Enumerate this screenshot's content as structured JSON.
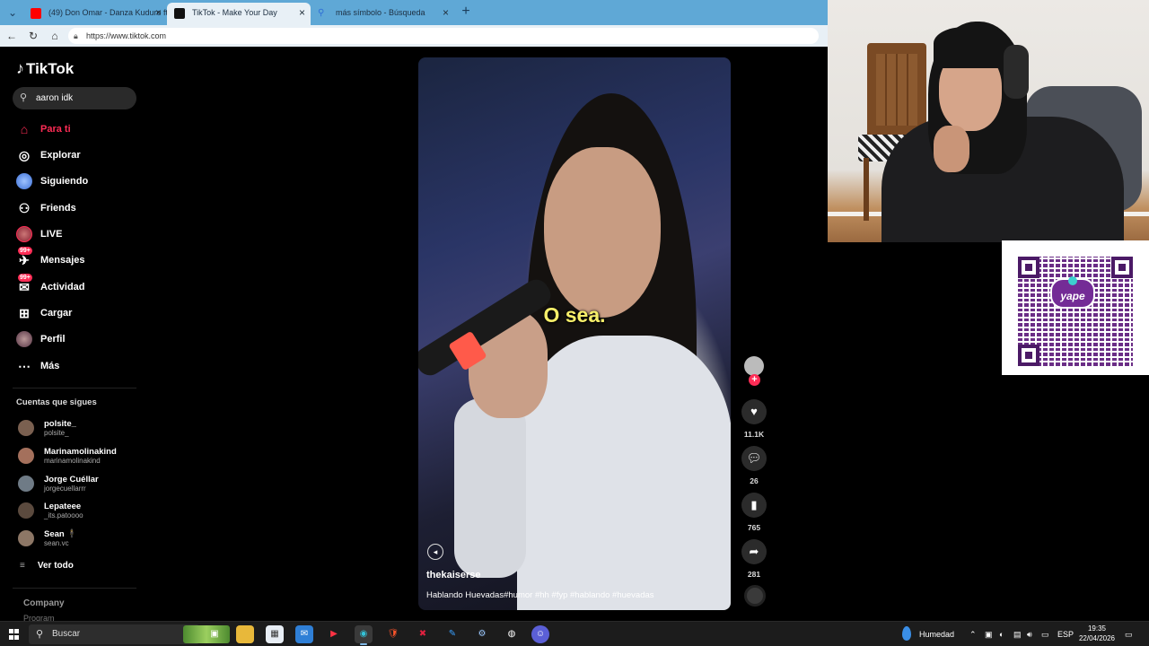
{
  "browser": {
    "tabs": [
      {
        "title": "(49) Don Omar - Danza Kuduro ft",
        "favicon_color": "#ff0000",
        "active": false
      },
      {
        "title": "TikTok - Make Your Day",
        "favicon_color": "#111111",
        "active": true
      },
      {
        "title": "más símbolo - Búsqueda",
        "favicon_color": "#2f6fd6",
        "active": false
      }
    ],
    "url": "https://www.tiktok.com"
  },
  "tiktok": {
    "logo": "TikTok",
    "search_value": "aaron idk",
    "nav": [
      {
        "label": "Para ti",
        "icon": "home-icon",
        "active": true
      },
      {
        "label": "Explorar",
        "icon": "compass-icon"
      },
      {
        "label": "Siguiendo",
        "icon": "following-avatar-icon"
      },
      {
        "label": "Friends",
        "icon": "friends-icon"
      },
      {
        "label": "LIVE",
        "icon": "live-icon"
      },
      {
        "label": "Mensajes",
        "icon": "messages-icon",
        "badge": "99+"
      },
      {
        "label": "Actividad",
        "icon": "activity-icon",
        "badge": "99+"
      },
      {
        "label": "Cargar",
        "icon": "upload-icon"
      },
      {
        "label": "Perfil",
        "icon": "profile-icon"
      },
      {
        "label": "Más",
        "icon": "more-icon"
      }
    ],
    "following_title": "Cuentas que sigues",
    "following": [
      {
        "name": "polsite_",
        "handle": "polsite_"
      },
      {
        "name": "Marinamolinakind",
        "handle": "marinamolinakind"
      },
      {
        "name": "Jorge Cuéllar",
        "handle": "jorgecuellarrr"
      },
      {
        "name": "Lepateee",
        "handle": "_its.patoooo"
      },
      {
        "name": "Sean 🕴",
        "handle": "sean.vc"
      }
    ],
    "see_all": "Ver todo",
    "company": "Company",
    "program": "Program"
  },
  "video": {
    "caption": "O sea.",
    "username": "thekaiserse",
    "description": "Hablando Huevadas#humor #hh #fyp #hablando #huevadas",
    "likes": "11.1K",
    "comments": "26",
    "bookmarks": "765",
    "shares": "281"
  },
  "qr": {
    "brand": "yape",
    "color": "#742c96"
  },
  "taskbar": {
    "search_placeholder": "Buscar",
    "weather": "Humedad",
    "language": "ESP",
    "time": "19:35",
    "date": "22/04/2026"
  }
}
